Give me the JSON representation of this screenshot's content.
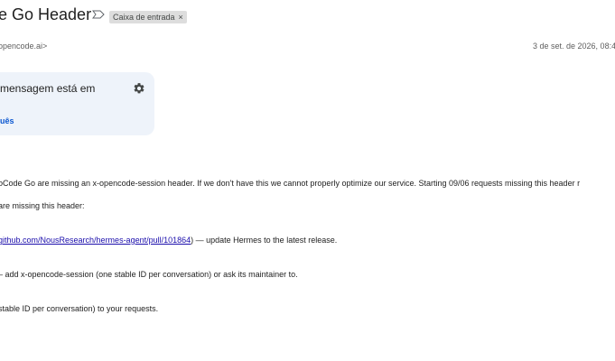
{
  "email": {
    "subject": "e Go Header",
    "label": "Caixa de entrada",
    "label_remove": "×",
    "sender": "opencode.ai>",
    "date": "3 de set. de 2026, 08:4"
  },
  "translate": {
    "title": "mensagem está em",
    "link": "uês"
  },
  "body": {
    "line1": "oCode Go are missing an x-opencode-session header. If we don't have this we cannot properly optimize our service. Starting 09/06 requests missing this header r",
    "line2": "are missing this header:",
    "line3_link": "github.com/NousResearch/hermes-agent/pull/101864",
    "line3_rest": ") — update Hermes to the latest release.",
    "line4": "– add x-opencode-session (one stable ID per conversation) or ask its maintainer to.",
    "line5": "stable ID per conversation) to your requests."
  },
  "icons": {
    "important": "important-marker-icon",
    "settings": "gear-icon",
    "close": "close-icon"
  },
  "colors": {
    "card_bg": "#eef3fa",
    "link_blue": "#0b57d0",
    "chip_bg": "#dddddd"
  }
}
